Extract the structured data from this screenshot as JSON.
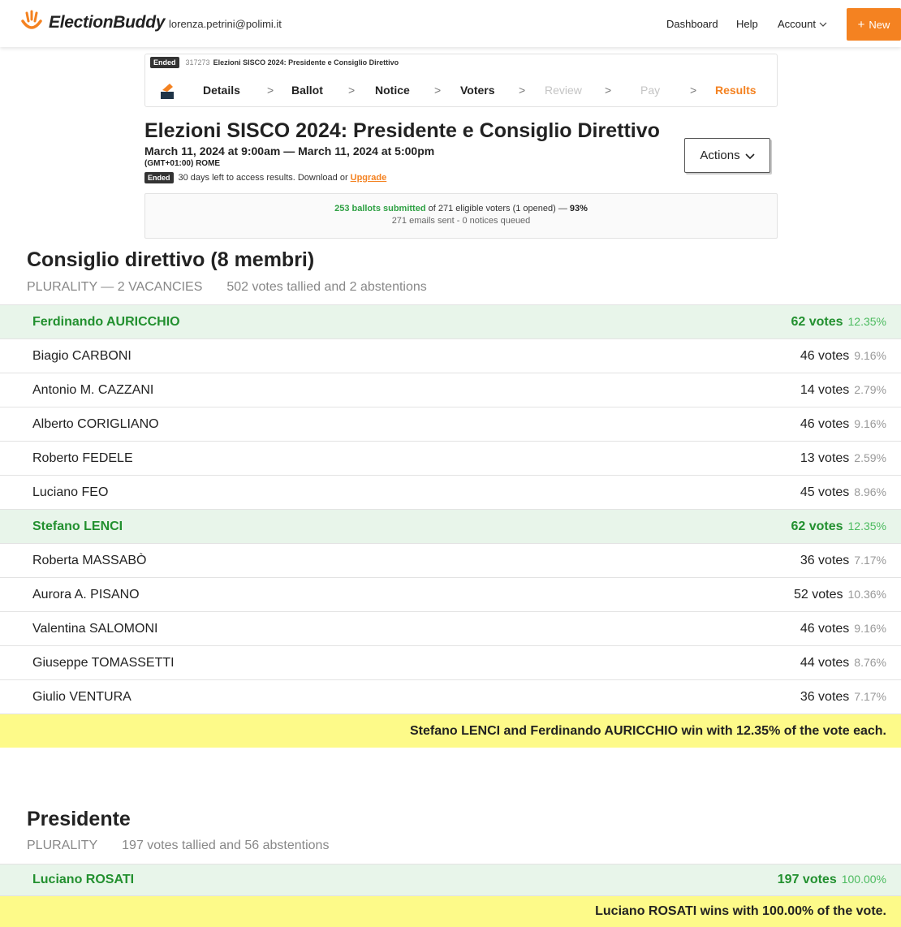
{
  "nav": {
    "brand": "ElectionBuddy",
    "user_email": "lorenza.petrini@polimi.it",
    "dashboard": "Dashboard",
    "help": "Help",
    "account": "Account",
    "new_label": "New",
    "new_icon": "plus-icon",
    "brand_color": "#f48221"
  },
  "election": {
    "status": "Ended",
    "id": "317273",
    "short_title": "Elezioni SISCO 2024: Presidente e Consiglio Direttivo",
    "title": "Elezioni SISCO 2024: Presidente e Consiglio Direttivo",
    "dates": "March 11, 2024 at 9:00am — March 11, 2024 at 5:00pm",
    "timezone": "(GMT+01:00) ROME",
    "status_text": "30 days left to access results. Download or",
    "upgrade_link": "Upgrade",
    "actions_label": "Actions"
  },
  "steps": [
    {
      "label": "Details",
      "state": "done"
    },
    {
      "label": "Ballot",
      "state": "done"
    },
    {
      "label": "Notice",
      "state": "done"
    },
    {
      "label": "Voters",
      "state": "done"
    },
    {
      "label": "Review",
      "state": "disabled"
    },
    {
      "label": "Pay",
      "state": "disabled"
    },
    {
      "label": "Results",
      "state": "active"
    }
  ],
  "summary": {
    "submitted": "253 ballots submitted",
    "eligible": " of 271 eligible voters (1 opened) — ",
    "percent": "93%",
    "emails": "271 emails sent - 0 notices queued"
  },
  "sections": [
    {
      "title": "Consiglio direttivo (8 membri)",
      "type": "PLURALITY — 2 VACANCIES",
      "tally": "502 votes tallied and 2 abstentions",
      "candidates": [
        {
          "name": "Ferdinando AURICCHIO",
          "votes": "62 votes",
          "pct": "12.35%",
          "winner": true
        },
        {
          "name": "Biagio CARBONI",
          "votes": "46 votes",
          "pct": "9.16%",
          "winner": false
        },
        {
          "name": "Antonio M. CAZZANI",
          "votes": "14 votes",
          "pct": "2.79%",
          "winner": false
        },
        {
          "name": "Alberto CORIGLIANO",
          "votes": "46 votes",
          "pct": "9.16%",
          "winner": false
        },
        {
          "name": "Roberto FEDELE",
          "votes": "13 votes",
          "pct": "2.59%",
          "winner": false
        },
        {
          "name": "Luciano FEO",
          "votes": "45 votes",
          "pct": "8.96%",
          "winner": false
        },
        {
          "name": "Stefano LENCI",
          "votes": "62 votes",
          "pct": "12.35%",
          "winner": true
        },
        {
          "name": "Roberta MASSABÒ",
          "votes": "36 votes",
          "pct": "7.17%",
          "winner": false
        },
        {
          "name": "Aurora A. PISANO",
          "votes": "52 votes",
          "pct": "10.36%",
          "winner": false
        },
        {
          "name": "Valentina SALOMONI",
          "votes": "46 votes",
          "pct": "9.16%",
          "winner": false
        },
        {
          "name": "Giuseppe TOMASSETTI",
          "votes": "44 votes",
          "pct": "8.76%",
          "winner": false
        },
        {
          "name": "Giulio VENTURA",
          "votes": "36 votes",
          "pct": "7.17%",
          "winner": false
        }
      ],
      "result": "Stefano LENCI and Ferdinando AURICCHIO win with 12.35% of the vote each."
    },
    {
      "title": "Presidente",
      "type": "PLURALITY",
      "tally": "197 votes tallied and 56 abstentions",
      "candidates": [
        {
          "name": "Luciano ROSATI",
          "votes": "197 votes",
          "pct": "100.00%",
          "winner": true
        }
      ],
      "result": "Luciano ROSATI wins with 100.00% of the vote."
    }
  ],
  "colors": {
    "winner_bg": "#e8f5ea",
    "winner_text": "#22902f",
    "banner_bg": "#fdfa89",
    "accent": "#f48221"
  }
}
